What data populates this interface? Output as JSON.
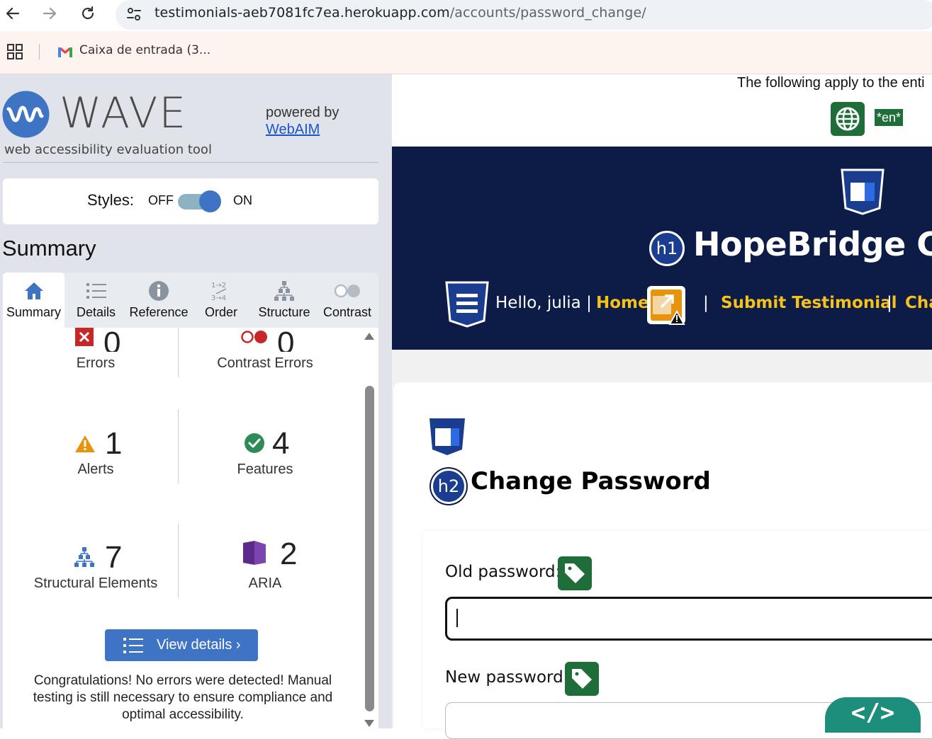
{
  "browser": {
    "url_host": "testimonials-aeb7081fc7ea.herokuapp.com",
    "url_path": "/accounts/password_change/",
    "bookmark_label": "Caixa de entrada (3..."
  },
  "wave": {
    "logo_text": "WAVE",
    "subtitle": "web accessibility evaluation tool",
    "powered_by": "powered by",
    "webaim_link": "WebAIM",
    "styles_label": "Styles:",
    "styles_off": "OFF",
    "styles_on": "ON",
    "styles_state": "on",
    "summary_heading": "Summary",
    "tabs": [
      {
        "label": "Summary",
        "icon": "home-icon",
        "selected": true
      },
      {
        "label": "Details",
        "icon": "list-icon",
        "selected": false
      },
      {
        "label": "Reference",
        "icon": "info-icon",
        "selected": false
      },
      {
        "label": "Order",
        "icon": "order-icon",
        "selected": false
      },
      {
        "label": "Structure",
        "icon": "structure-icon",
        "selected": false
      },
      {
        "label": "Contrast",
        "icon": "contrast-icon",
        "selected": false
      }
    ],
    "stats": {
      "errors": {
        "count": "0",
        "label": "Errors"
      },
      "contrast_errors": {
        "count": "0",
        "label": "Contrast Errors"
      },
      "alerts": {
        "count": "1",
        "label": "Alerts"
      },
      "features": {
        "count": "4",
        "label": "Features"
      },
      "structural": {
        "count": "7",
        "label": "Structural Elements"
      },
      "aria": {
        "count": "2",
        "label": "ARIA"
      }
    },
    "view_details": "View details ›",
    "congrats": "Congratulations! No errors were detected! Manual testing is still necessary to ensure compliance and optimal accessibility."
  },
  "page": {
    "apply_text": "The following apply to the enti",
    "lang_badge": "*en*",
    "h1_badge": "h1",
    "brand": "HopeBridge Co",
    "hello": "Hello, julia |",
    "nav": {
      "home": "Home",
      "sep1": "|",
      "submit": "Submit Testimonial",
      "sep2": "|",
      "change": "Cha"
    },
    "h2_badge": "h2",
    "heading": "Change Password",
    "old_password_label": "Old password:",
    "new_password_label": "New password:",
    "old_password_value": "",
    "code_tab": "</>"
  },
  "colors": {
    "wave_blue": "#3f73c4",
    "header_navy": "#0d1b47",
    "nav_link": "#f4c21a",
    "feature_green": "#1f6e3a",
    "error_red": "#c62828",
    "alert_orange": "#e8930c"
  }
}
